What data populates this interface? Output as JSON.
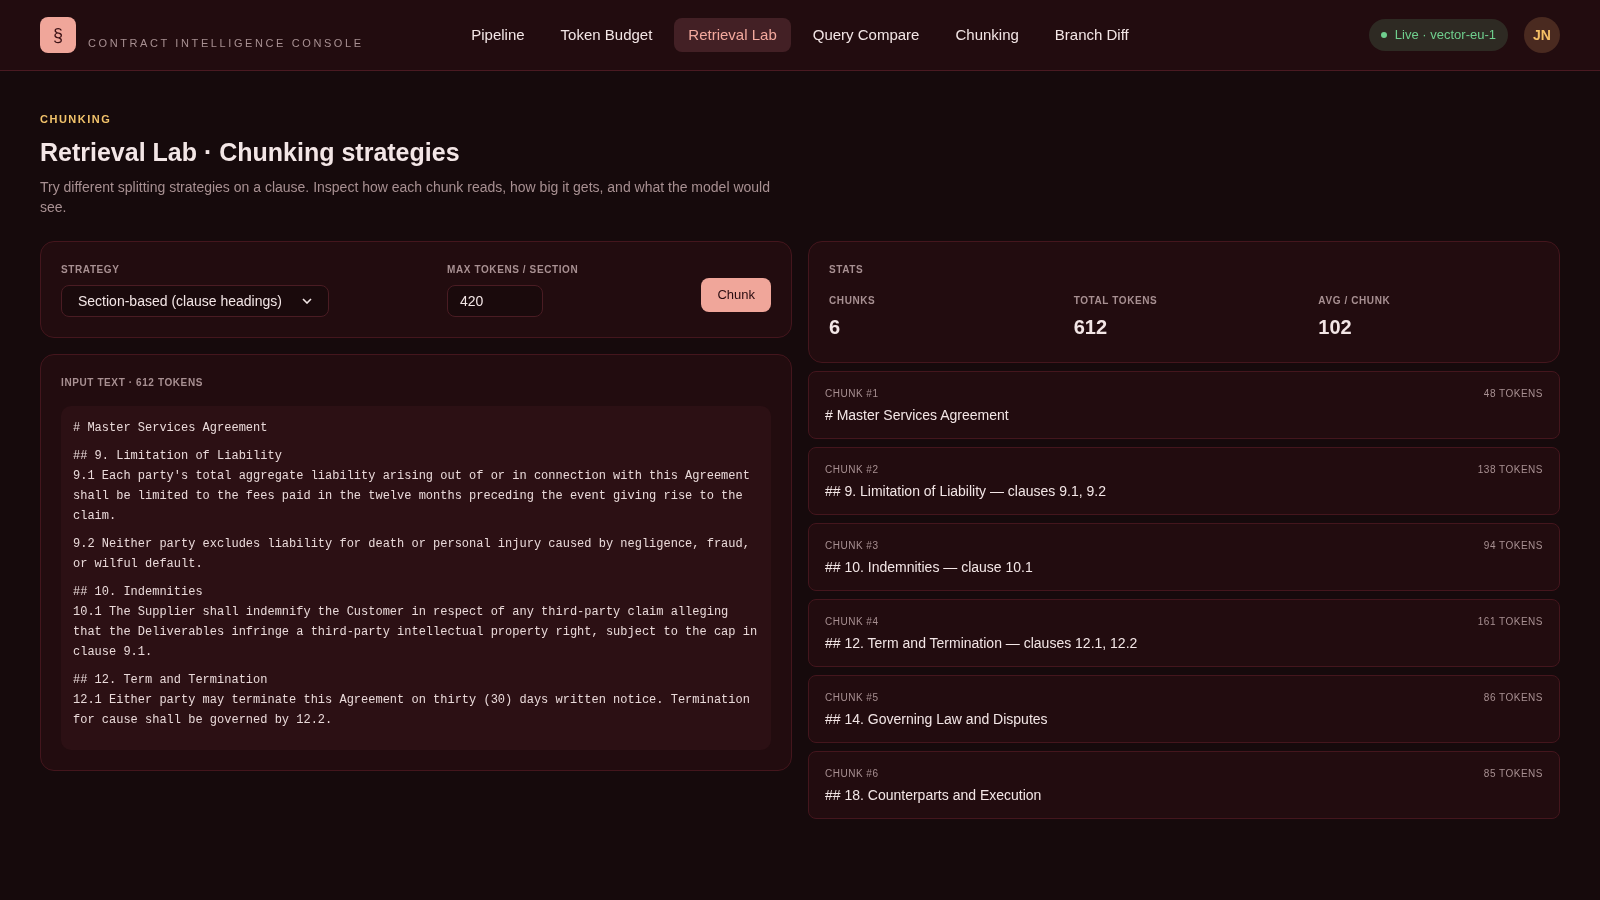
{
  "brand": {
    "logo": "§",
    "subtitle": "CONTRACT INTELLIGENCE CONSOLE"
  },
  "nav": [
    {
      "label": "Pipeline",
      "selected": false
    },
    {
      "label": "Token Budget",
      "selected": false
    },
    {
      "label": "Retrieval Lab",
      "selected": true
    },
    {
      "label": "Query Compare",
      "selected": false
    },
    {
      "label": "Chunking",
      "selected": false
    },
    {
      "label": "Branch Diff",
      "selected": false
    }
  ],
  "status": {
    "label": "Live · vector-eu-1",
    "color": "#6fcf8e"
  },
  "avatar": "JN",
  "page": {
    "eyebrow": "CHUNKING",
    "title": "Retrieval Lab · Chunking strategies",
    "description": "Try different splitting strategies on a clause. Inspect how each chunk reads, how big it gets, and what the model would see."
  },
  "controls": {
    "strategy_label": "STRATEGY",
    "strategy": "Section-based (clause headings)",
    "max_label": "MAX TOKENS / SECTION",
    "max_value": "420",
    "button": "Chunk"
  },
  "input": {
    "label": "INPUT TEXT · 612 TOKENS",
    "paragraphs": [
      "# Master Services Agreement",
      "## 9. Limitation of Liability\n9.1 Each party's total aggregate liability arising out of or in connection with this Agreement shall be limited to the fees paid in the twelve months preceding the event giving rise to the claim.",
      "9.2 Neither party excludes liability for death or personal injury caused by negligence, fraud, or wilful default.",
      "## 10. Indemnities\n10.1 The Supplier shall indemnify the Customer in respect of any third-party claim alleging that the Deliverables infringe a third-party intellectual property right, subject to the cap in clause 9.1.",
      "## 12. Term and Termination\n12.1 Either party may terminate this Agreement on thirty (30) days written notice. Termination for cause shall be governed by 12.2."
    ]
  },
  "stats": {
    "title": "STATS",
    "items": [
      {
        "label": "CHUNKS",
        "value": "6"
      },
      {
        "label": "TOTAL TOKENS",
        "value": "612"
      },
      {
        "label": "AVG / CHUNK",
        "value": "102"
      }
    ]
  },
  "chunks": [
    {
      "label": "CHUNK #1",
      "tokens": "48 TOKENS",
      "text": "# Master Services Agreement"
    },
    {
      "label": "CHUNK #2",
      "tokens": "138 TOKENS",
      "text": "## 9. Limitation of Liability — clauses 9.1, 9.2"
    },
    {
      "label": "CHUNK #3",
      "tokens": "94 TOKENS",
      "text": "## 10. Indemnities — clause 10.1"
    },
    {
      "label": "CHUNK #4",
      "tokens": "161 TOKENS",
      "text": "## 12. Term and Termination — clauses 12.1, 12.2"
    },
    {
      "label": "CHUNK #5",
      "tokens": "86 TOKENS",
      "text": "## 14. Governing Law and Disputes"
    },
    {
      "label": "CHUNK #6",
      "tokens": "85 TOKENS",
      "text": "## 18. Counterparts and Execution"
    }
  ]
}
